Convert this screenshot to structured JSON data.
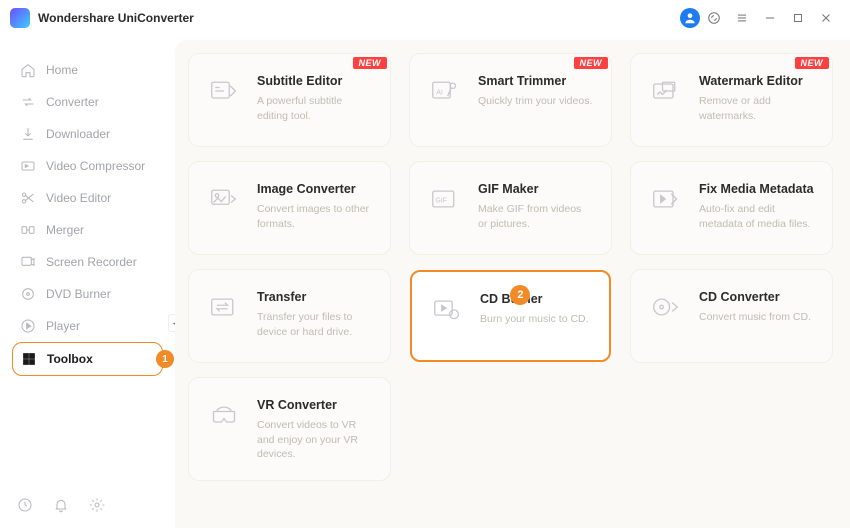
{
  "app_title": "Wondershare UniConverter",
  "sidebar": {
    "items": [
      {
        "label": "Home"
      },
      {
        "label": "Converter"
      },
      {
        "label": "Downloader"
      },
      {
        "label": "Video Compressor"
      },
      {
        "label": "Video Editor"
      },
      {
        "label": "Merger"
      },
      {
        "label": "Screen Recorder"
      },
      {
        "label": "DVD Burner"
      },
      {
        "label": "Player"
      },
      {
        "label": "Toolbox"
      }
    ],
    "active_index": 9,
    "active_badge": "1"
  },
  "callout_badge": "2",
  "new_label": "NEW",
  "cards": [
    {
      "title": "Subtitle Editor",
      "desc": "A powerful subtitle editing tool.",
      "new": true
    },
    {
      "title": "Smart Trimmer",
      "desc": "Quickly trim your videos.",
      "new": true
    },
    {
      "title": "Watermark Editor",
      "desc": "Remove or add watermarks.",
      "new": true
    },
    {
      "title": "Image Converter",
      "desc": "Convert images to other formats.",
      "new": false
    },
    {
      "title": "GIF Maker",
      "desc": "Make GIF from videos or pictures.",
      "new": false
    },
    {
      "title": "Fix Media Metadata",
      "desc": "Auto-fix and edit metadata of media files.",
      "new": false
    },
    {
      "title": "Transfer",
      "desc": "Transfer your files to device or hard drive.",
      "new": false
    },
    {
      "title": "CD Burner",
      "desc": "Burn your music to CD.",
      "new": false,
      "highlight": true
    },
    {
      "title": "CD Converter",
      "desc": "Convert music from CD.",
      "new": false
    },
    {
      "title": "VR Converter",
      "desc": "Convert videos to VR and enjoy on your VR devices.",
      "new": false
    }
  ]
}
